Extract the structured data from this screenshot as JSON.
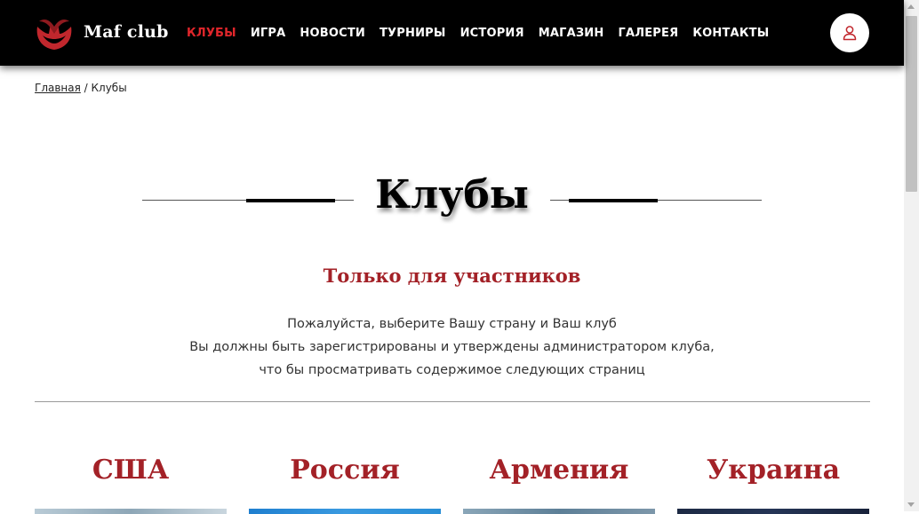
{
  "brand": {
    "name": "Maf club",
    "accent": "#e0262b",
    "logo_icon": "mafia-mask-logo-icon"
  },
  "nav": {
    "items": [
      {
        "label": "КЛУБЫ",
        "active": true
      },
      {
        "label": "ИГРА",
        "active": false
      },
      {
        "label": "НОВОСТИ",
        "active": false
      },
      {
        "label": "ТУРНИРЫ",
        "active": false
      },
      {
        "label": "ИСТОРИЯ",
        "active": false
      },
      {
        "label": "МАГАЗИН",
        "active": false
      },
      {
        "label": "ГАЛЕРЕЯ",
        "active": false
      },
      {
        "label": "КОНТАКТЫ",
        "active": false
      }
    ],
    "user_icon": "user-icon"
  },
  "breadcrumb": {
    "home": "Главная",
    "separator": " / ",
    "current": "Клубы"
  },
  "page": {
    "title": "Клубы",
    "subtitle": "Только для участников",
    "description": [
      "Пожалуйста, выберите Вашу страну и Ваш клуб",
      "Вы должны быть зарегистрированы и утверждены администратором клуба,",
      "что бы просматривать содержимое следующих страниц"
    ]
  },
  "countries": [
    {
      "name": "США",
      "image_color": "#9fb6c4"
    },
    {
      "name": "Россия",
      "image_color": "#2a8fd6"
    },
    {
      "name": "Армения",
      "image_color": "#6f8fa6"
    },
    {
      "name": "Украина",
      "image_color": "#1d2a44"
    }
  ],
  "colors": {
    "heading_red": "#a32127",
    "header_bg": "#000000"
  }
}
